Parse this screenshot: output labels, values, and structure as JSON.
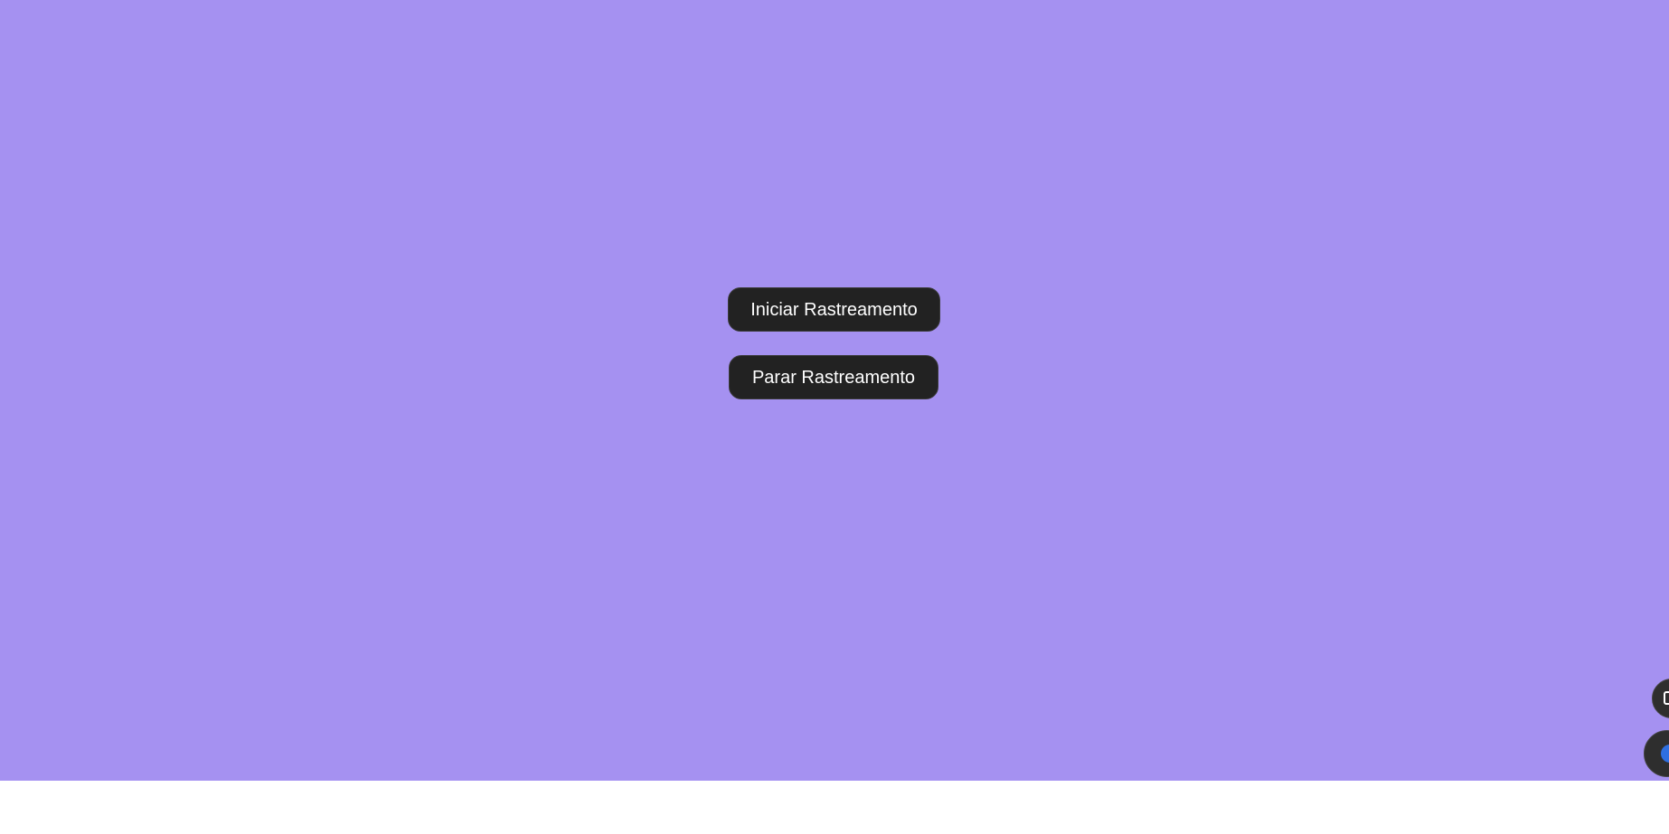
{
  "page": {
    "background_color": "#a591f1",
    "footer_color": "#ffffff"
  },
  "actions": {
    "start_label": "Iniciar Rastreamento",
    "stop_label": "Parar Rastreamento",
    "button_color": "#222222",
    "button_text_color": "#ffffff"
  },
  "floating": {
    "top_icon": "copy-icon",
    "bottom_icon": "globe-icon",
    "bottom_icon_color": "#2f6fe0"
  }
}
